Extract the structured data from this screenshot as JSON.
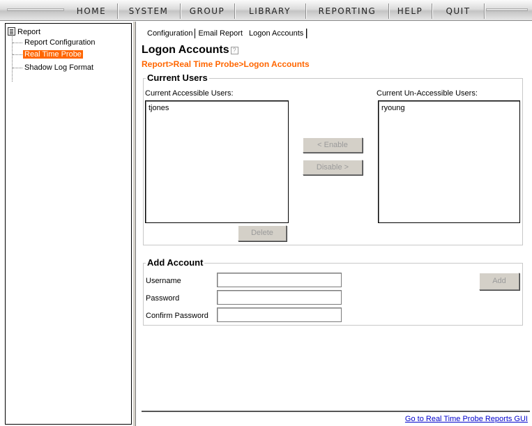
{
  "nav": {
    "items": [
      "HOME",
      "SYSTEM",
      "GROUP",
      "LIBRARY",
      "REPORTING",
      "HELP",
      "QUIT"
    ]
  },
  "tree": {
    "root": "Report",
    "items": [
      {
        "label": "Report Configuration",
        "selected": false
      },
      {
        "label": "Real Time Probe",
        "selected": true
      },
      {
        "label": "Shadow Log Format",
        "selected": false
      }
    ]
  },
  "tabs": [
    "Configuration",
    "Email Report",
    "Logon Accounts"
  ],
  "active_tab": "Logon Accounts",
  "page": {
    "title": "Logon Accounts",
    "help_icon": "help-icon",
    "breadcrumb": "Report>Real Time Probe>Logon Accounts"
  },
  "current_users": {
    "legend": "Current Users",
    "accessible_label": "Current Accessible Users:",
    "accessible": [
      "tjones"
    ],
    "inaccessible_label": "Current Un-Accessible Users:",
    "inaccessible": [
      "ryoung"
    ],
    "enable_button": "< Enable",
    "disable_button": "Disable >",
    "delete_button": "Delete"
  },
  "add_account": {
    "legend": "Add Account",
    "username_label": "Username",
    "password_label": "Password",
    "confirm_label": "Confirm Password",
    "username_value": "",
    "password_value": "",
    "confirm_value": "",
    "add_button": "Add"
  },
  "footer": {
    "link": "Go to Real Time Probe Reports GUI"
  },
  "colors": {
    "accent": "#ff6600",
    "link": "#0000cc"
  }
}
